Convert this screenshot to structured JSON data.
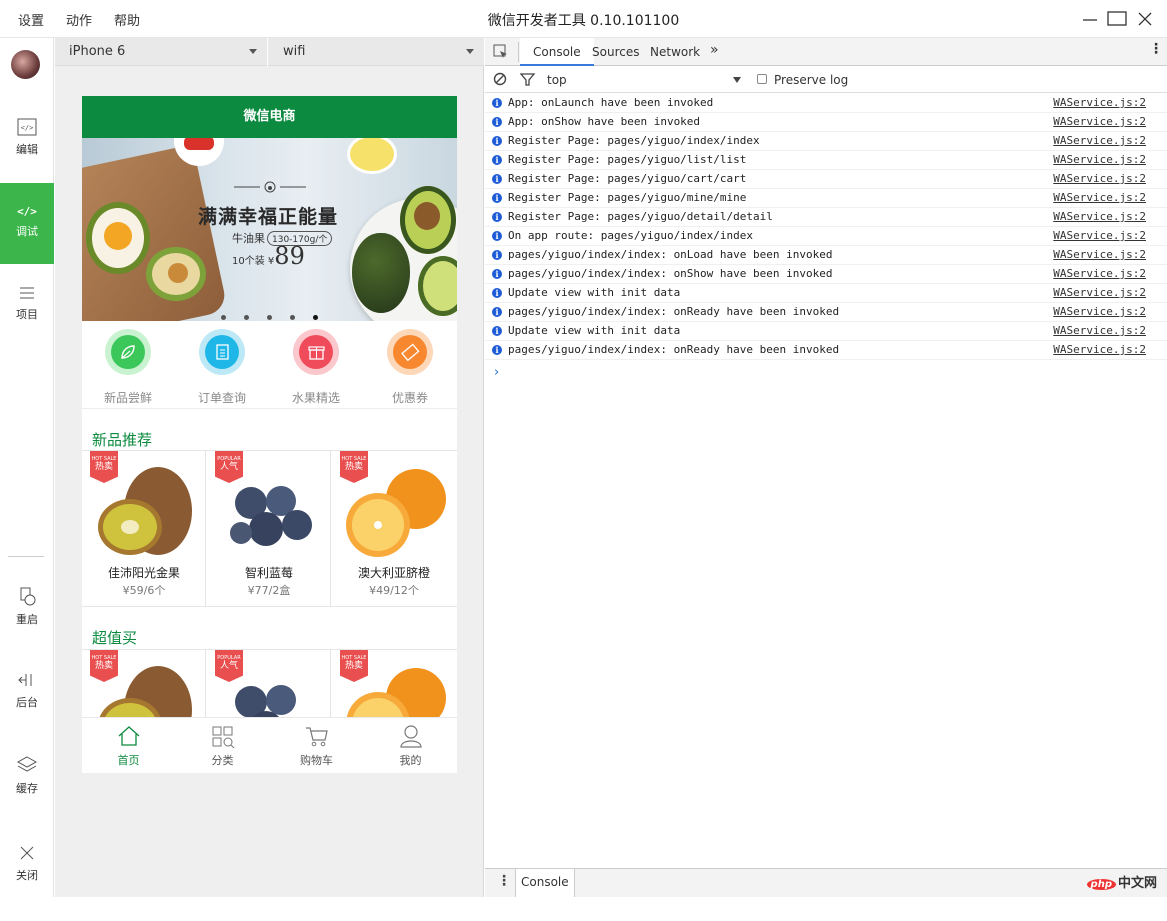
{
  "menu": {
    "settings": "设置",
    "actions": "动作",
    "help": "帮助"
  },
  "window_title": "微信开发者工具 0.10.101100",
  "sidebar": {
    "items": [
      {
        "label": "编辑",
        "icon": "code-icon"
      },
      {
        "label": "调试",
        "icon": "debug-icon",
        "active": true
      },
      {
        "label": "项目",
        "icon": "menu-icon"
      },
      {
        "label": "重启",
        "icon": "restart-icon"
      },
      {
        "label": "后台",
        "icon": "background-icon"
      },
      {
        "label": "缓存",
        "icon": "layers-icon"
      },
      {
        "label": "关闭",
        "icon": "close-icon"
      }
    ]
  },
  "simulator": {
    "device": "iPhone 6",
    "network": "wifi"
  },
  "app": {
    "nav_title": "微信电商",
    "banner": {
      "title": "满满幸福正能量",
      "product": "牛油果",
      "spec": "130-170g/个",
      "qty": "10个装",
      "currency": "¥",
      "price": "89",
      "dots": 5,
      "active_dot": 4
    },
    "quick_links": [
      {
        "label": "新品尝鲜",
        "color": "#3cc75a",
        "ring": "#b9f0c4"
      },
      {
        "label": "订单查询",
        "color": "#1fb6e8",
        "ring": "#b8e8f7"
      },
      {
        "label": "水果精选",
        "color": "#f04b5a",
        "ring": "#fac1c6"
      },
      {
        "label": "优惠券",
        "color": "#f7882f",
        "ring": "#fcd3b0"
      }
    ],
    "sections": [
      {
        "title": "新品推荐",
        "products": [
          {
            "name": "佳沛阳光金果",
            "price": "¥59/6个",
            "badge_top": "HOT SALE",
            "badge": "热卖"
          },
          {
            "name": "智利蓝莓",
            "price": "¥77/2盒",
            "badge_top": "POPULAR",
            "badge": "人气"
          },
          {
            "name": "澳大利亚脐橙",
            "price": "¥49/12个",
            "badge_top": "HOT SALE",
            "badge": "热卖"
          }
        ]
      },
      {
        "title": "超值买",
        "products": [
          {
            "badge_top": "HOT SALE",
            "badge": "热卖"
          },
          {
            "badge_top": "POPULAR",
            "badge": "人气"
          },
          {
            "badge_top": "HOT SALE",
            "badge": "热卖"
          }
        ]
      }
    ],
    "tabs": [
      {
        "label": "首页",
        "active": true
      },
      {
        "label": "分类"
      },
      {
        "label": "购物车"
      },
      {
        "label": "我的"
      }
    ]
  },
  "devtools": {
    "tabs": [
      "Console",
      "Sources",
      "Network"
    ],
    "active_tab": "Console",
    "context": "top",
    "preserve_log": "Preserve log",
    "logs": [
      {
        "msg": "App: onLaunch have been invoked",
        "src": "WAService.js:2"
      },
      {
        "msg": "App: onShow have been invoked",
        "src": "WAService.js:2"
      },
      {
        "msg": "Register Page: pages/yiguo/index/index",
        "src": "WAService.js:2"
      },
      {
        "msg": "Register Page: pages/yiguo/list/list",
        "src": "WAService.js:2"
      },
      {
        "msg": "Register Page: pages/yiguo/cart/cart",
        "src": "WAService.js:2"
      },
      {
        "msg": "Register Page: pages/yiguo/mine/mine",
        "src": "WAService.js:2"
      },
      {
        "msg": "Register Page: pages/yiguo/detail/detail",
        "src": "WAService.js:2"
      },
      {
        "msg": "On app route: pages/yiguo/index/index",
        "src": "WAService.js:2"
      },
      {
        "msg": "pages/yiguo/index/index: onLoad have been invoked",
        "src": "WAService.js:2"
      },
      {
        "msg": "pages/yiguo/index/index: onShow have been invoked",
        "src": "WAService.js:2"
      },
      {
        "msg": "Update view with init data",
        "src": "WAService.js:2"
      },
      {
        "msg": "pages/yiguo/index/index: onReady have been invoked",
        "src": "WAService.js:2"
      },
      {
        "msg": "Update view with init data",
        "src": "WAService.js:2"
      },
      {
        "msg": "pages/yiguo/index/index: onReady have been invoked",
        "src": "WAService.js:2"
      }
    ],
    "drawer_tab": "Console"
  },
  "watermark": "php中文网"
}
